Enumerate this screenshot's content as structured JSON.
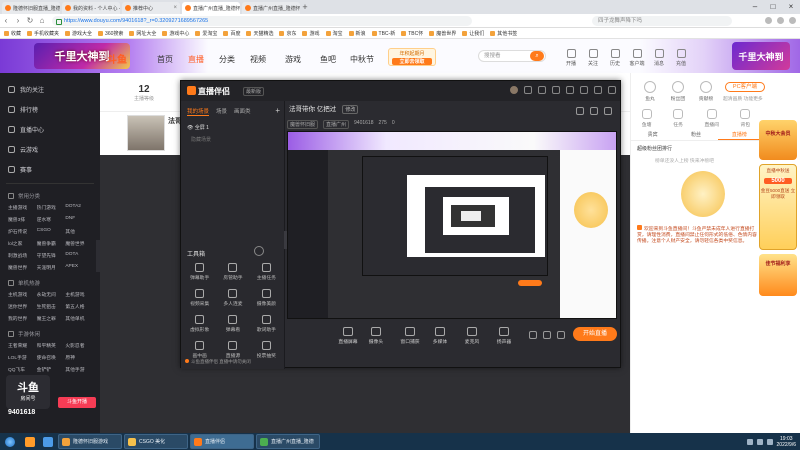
{
  "browser": {
    "tabs": [
      {
        "label": "隆德怀旧服直播_隆德怀旧服游",
        "active": false,
        "color": "#ff7a1a"
      },
      {
        "label": "我的资料 - 个人中心 - 斗鱼",
        "active": false,
        "color": "#ff7a1a"
      },
      {
        "label": "推荐中心",
        "active": false,
        "color": "#ff7a1a"
      },
      {
        "label": "直播广州直播_隆德怀旧服",
        "active": true,
        "color": "#ff7a1a"
      },
      {
        "label": "直播广州直播_隆德怀旧服",
        "active": false,
        "color": "#ff7a1a"
      }
    ],
    "url": "https://www.douyu.com/9401618?_r=0.3209271689567265",
    "search_placeholder": "四子龙舞声降下吗",
    "bookmarks": [
      "收藏",
      "手机收藏夹",
      "游戏大全",
      "360搜索",
      "网址大全",
      "游戏中心",
      "爱淘宝",
      "百度",
      "天猫精选",
      "京东",
      "游戏",
      "淘宝",
      "新浪",
      "TBC-新",
      "TBC怀",
      "魔兽世界",
      "让我们",
      "其他书签"
    ]
  },
  "site": {
    "brand": "斗鱼",
    "banner_left": "千里大神到",
    "banner_right": "千里大神到",
    "nav": [
      "首页",
      "直播",
      "分类",
      "视频",
      "游戏",
      "鱼吧",
      "中秋节"
    ],
    "active_nav": "直播",
    "promo_title": "年积起期月",
    "promo_cta": "立即去领取",
    "search_placeholder": "搜搜看",
    "header_icons": [
      "开播",
      "关注",
      "历史",
      "客户端",
      "消息",
      "充值"
    ]
  },
  "sidebar": {
    "items": [
      "我的关注",
      "排行榜",
      "直播中心",
      "云游戏",
      "赛事"
    ],
    "sections": [
      {
        "title": "常用分类",
        "cells": [
          "主播游戏",
          "热门游戏",
          "DOTA2",
          "魔兽3排",
          "逆水寒",
          "DNF",
          "炉石传说",
          "CSGO",
          "其他",
          "lol之家",
          "魔兽争霸",
          "魔兽世界",
          "刺激战场",
          "守望先锋",
          "DOTA",
          "魔兽世界",
          "天涯明月",
          "APEX"
        ]
      },
      {
        "title": "单机热游",
        "cells": [
          "主机游戏",
          "永劫无间",
          "主机游戏",
          "迷你世界",
          "生死狙击",
          "第五人格",
          "我的世界",
          "魔王之罪",
          "其他单机"
        ]
      },
      {
        "title": "手游休闲",
        "cells": [
          "王者荣耀",
          "和平精英",
          "火影忍者",
          "LOL手游",
          "使命召唤",
          "原神",
          "QQ飞车",
          "金铲铲",
          "其他手游"
        ]
      }
    ],
    "room_no": "9401618",
    "logo_text": "斗鱼",
    "logo_sub": "房间号",
    "shop_label": "斗鱼开播"
  },
  "room": {
    "followers": "12",
    "followers_label": "主播等级",
    "anchor_name": "法哥"
  },
  "obs": {
    "title": "直播伴侣",
    "version": "最新版",
    "tabs": [
      "我的场景",
      "场景",
      "画面类"
    ],
    "active_tab": "我的场景",
    "scene_name": "全屏 1",
    "scene_sub": "隐藏场景",
    "room_title": "法哥带你 亿把过",
    "room_tag": "修改",
    "meta": [
      "魔兽怀旧服",
      "直播广州",
      "9401618",
      "275",
      "0"
    ],
    "tools_title": "工具箱",
    "tools": [
      "弹幕助手",
      "房管助手",
      "主播任务",
      "视频采集",
      "多人连麦",
      "摄像美颜",
      "虚拟形象",
      "弹幕看",
      "歌词助手",
      "画中画",
      "直播源",
      "投票抽奖"
    ],
    "tip": "斗鱼直播伴侣 直播中请勿关闭",
    "bottom_buttons": [
      "直播屏幕",
      "摄像头",
      "窗口捕获",
      "多媒体",
      "麦克风",
      "扬声器"
    ],
    "start_label": "开始直播"
  },
  "right_panel": {
    "top_icons": [
      "鱼丸",
      "粉丝团",
      "贡献榜"
    ],
    "pc_btn": "PC客户端",
    "pc_sub": "超清画质 功能更多",
    "row1": [
      "鱼塘",
      "任务",
      "直播间",
      "背包"
    ],
    "tabs": [
      "贵宾",
      "粉丝",
      "直播榜"
    ],
    "active_tab": "直播榜",
    "rank_label": "超级粉丝团排行",
    "rank_empty": "榜单还没人上榜 快来冲榜吧",
    "mascot_msg": "暂时没人上榜哦~",
    "notice": "欢迎来到斗鱼直播间！斗鱼严禁未成年人进行直播打赏，请理性消费，直播间禁止任何形式的低俗、色情内容传播。注意个人财产安全，请勿轻信各类中奖信息。",
    "ad1": "中秋大会员",
    "ad2_title": "直播中秋送",
    "ad2_amount": "5000",
    "ad2_sub": "金豆5000直送 立即领取",
    "ad3": "佳节福利享"
  },
  "taskbar": {
    "apps": [
      {
        "label": "隆德怀旧服游戏",
        "color": "#f3a23b",
        "active": false
      },
      {
        "label": "CSGO 美化",
        "color": "#f6c14c",
        "active": false
      },
      {
        "label": "直播伴侣",
        "color": "#ff7a1a",
        "active": true
      },
      {
        "label": "直播广州直播_隆德",
        "color": "#4caf50",
        "active": false
      }
    ],
    "pins": [
      "#ff9c2a",
      "#4c9be8"
    ],
    "time": "19:03",
    "date": "2022/9/6"
  }
}
